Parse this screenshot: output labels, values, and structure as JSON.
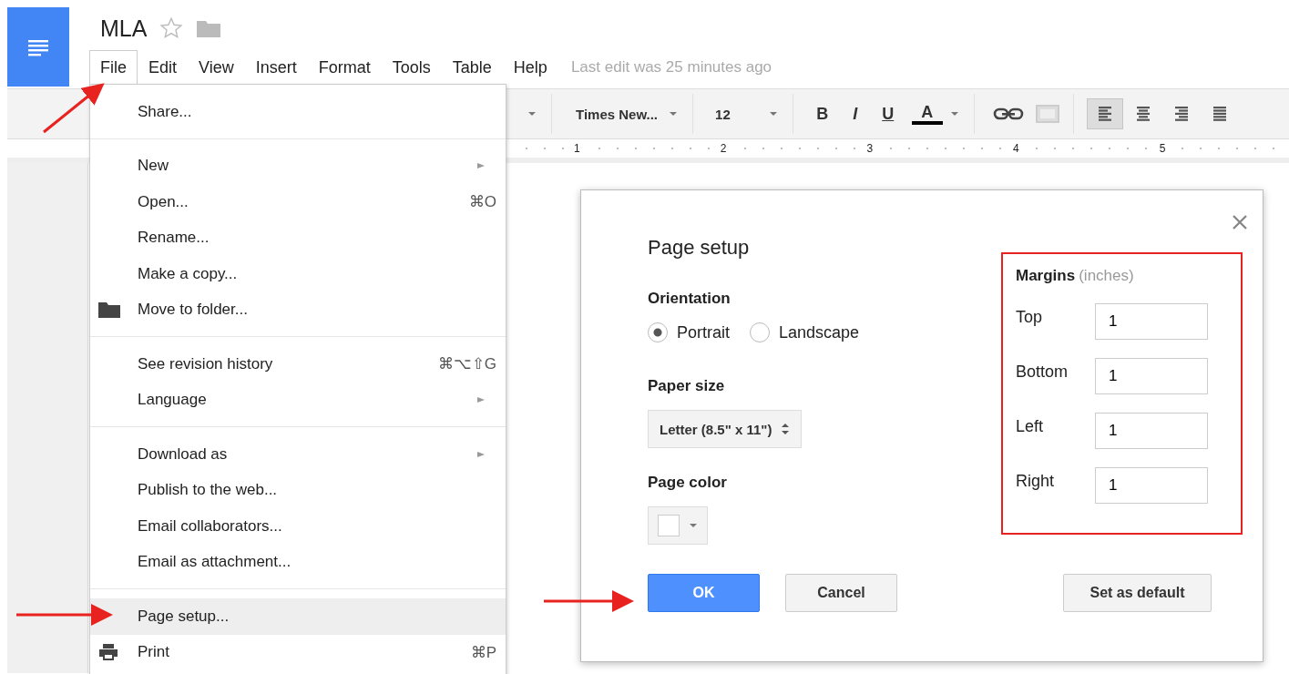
{
  "document": {
    "title": "MLA",
    "starred": false,
    "last_edit": "Last edit was 25 minutes ago"
  },
  "menubar": [
    {
      "label": "File",
      "selected": true
    },
    {
      "label": "Edit",
      "selected": false
    },
    {
      "label": "View",
      "selected": false
    },
    {
      "label": "Insert",
      "selected": false
    },
    {
      "label": "Format",
      "selected": false
    },
    {
      "label": "Tools",
      "selected": false
    },
    {
      "label": "Table",
      "selected": false
    },
    {
      "label": "Help",
      "selected": false
    }
  ],
  "toolbar": {
    "font": "Times New...",
    "size": "12",
    "format_buttons": [
      "B",
      "I",
      "U"
    ],
    "text_color": {
      "label": "A",
      "color": "#000000"
    },
    "align_buttons": [
      {
        "selected": true
      },
      {
        "selected": false
      },
      {
        "selected": false
      },
      {
        "selected": false
      }
    ]
  },
  "ruler": [
    "1",
    "2",
    "3",
    "4",
    "5"
  ],
  "file_menu": [
    {
      "items": [
        {
          "label": "Share...",
          "submenu": false,
          "selected": false
        }
      ]
    },
    {
      "items": [
        {
          "label": "New",
          "submenu": true,
          "selected": false
        },
        {
          "label": "Open...",
          "shortcut": "⌘O",
          "submenu": false,
          "selected": false
        },
        {
          "label": "Rename...",
          "submenu": false,
          "selected": false
        },
        {
          "label": "Make a copy...",
          "submenu": false,
          "selected": false
        },
        {
          "label": "Move to folder...",
          "kind": "move",
          "submenu": false,
          "selected": false
        }
      ]
    },
    {
      "items": [
        {
          "label": "See revision history",
          "shortcut": "⌘⌥⇧G",
          "submenu": false,
          "selected": false
        },
        {
          "label": "Language",
          "submenu": true,
          "selected": false
        }
      ]
    },
    {
      "items": [
        {
          "label": "Download as",
          "submenu": true,
          "selected": false
        },
        {
          "label": "Publish to the web...",
          "submenu": false,
          "selected": false
        },
        {
          "label": "Email collaborators...",
          "submenu": false,
          "selected": false
        },
        {
          "label": "Email as attachment...",
          "submenu": false,
          "selected": false
        }
      ]
    },
    {
      "items": [
        {
          "label": "Page setup...",
          "submenu": false,
          "selected": true
        },
        {
          "label": "Print",
          "kind": "print",
          "shortcut": "⌘P",
          "submenu": false,
          "selected": false
        }
      ]
    }
  ],
  "dialog": {
    "title": "Page setup",
    "orientation": {
      "label": "Orientation",
      "options": [
        {
          "label": "Portrait",
          "selected": true
        },
        {
          "label": "Landscape",
          "selected": false
        }
      ]
    },
    "paper_size": {
      "label": "Paper size",
      "value": "Letter (8.5\" x 11\")"
    },
    "page_color": {
      "label": "Page color",
      "color": "#ffffff"
    },
    "margins": {
      "label": "Margins",
      "unit": "(inches)",
      "fields": [
        {
          "label": "Top",
          "value": "1"
        },
        {
          "label": "Bottom",
          "value": "1"
        },
        {
          "label": "Left",
          "value": "1"
        },
        {
          "label": "Right",
          "value": "1"
        }
      ]
    },
    "buttons": [
      {
        "label": "OK",
        "kind": "primary"
      },
      {
        "label": "Cancel",
        "kind": "default"
      },
      {
        "label": "Set as default",
        "kind": "default"
      }
    ]
  }
}
